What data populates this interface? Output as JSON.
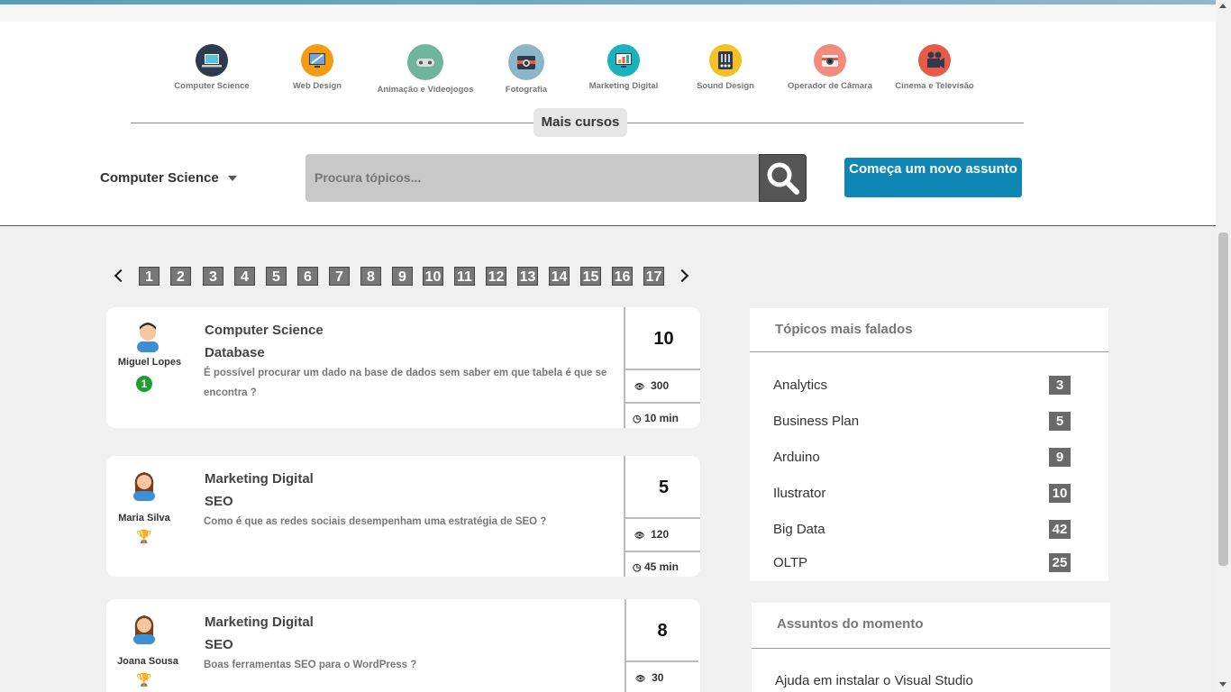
{
  "categories": [
    {
      "label": "Computer Science",
      "icon": "laptop-icon",
      "color": "#2e3b4e"
    },
    {
      "label": "Web Design",
      "icon": "web-design-icon",
      "color": "#f39c12"
    },
    {
      "label": "Animação e Videojogos",
      "icon": "gamepad-icon",
      "color": "#6fb59d"
    },
    {
      "label": "Fotografia",
      "icon": "camera-icon",
      "color": "#8bb5c9"
    },
    {
      "label": "Marketing Digital",
      "icon": "chart-screen-icon",
      "color": "#1ab2bc"
    },
    {
      "label": "Sound Design",
      "icon": "mixer-icon",
      "color": "#f4c022"
    },
    {
      "label": "Operador de Câmara",
      "icon": "camera-operator-icon",
      "color": "#f08b7e"
    },
    {
      "label": "Cinema e Televisão",
      "icon": "film-camera-icon",
      "color": "#e85a46"
    }
  ],
  "more_courses": "Mais cursos",
  "filter": {
    "selected": "Computer Science"
  },
  "search": {
    "placeholder": "Procura tópicos..."
  },
  "new_topic_button": "Começa um novo assunto",
  "pagination": {
    "pages": [
      "1",
      "2",
      "3",
      "4",
      "5",
      "6",
      "7",
      "8",
      "9",
      "10",
      "11",
      "12",
      "13",
      "14",
      "15",
      "16",
      "17"
    ]
  },
  "posts": [
    {
      "user": "Miguel Lopes",
      "badge": "1",
      "category": "Computer Science",
      "subcategory": "Database",
      "question": "É possível procurar um dado na base de dados sem saber em que tabela é que se encontra ?",
      "replies": "10",
      "views": "300",
      "time": "10 min"
    },
    {
      "user": "Maria Silva",
      "badge": "trophy",
      "category": "Marketing Digital",
      "subcategory": "SEO",
      "question": "Como é que as redes sociais desempenham uma estratégia de SEO ?",
      "replies": "5",
      "views": "120",
      "time": "45 min"
    },
    {
      "user": "Joana Sousa",
      "badge": "trophy",
      "category": "Marketing Digital",
      "subcategory": "SEO",
      "question": "Boas ferramentas SEO para o WordPress ?",
      "replies": "8",
      "views": "30",
      "time": ""
    }
  ],
  "top_topics": {
    "title": "Tópicos mais falados",
    "items": [
      {
        "name": "Analytics",
        "count": "3"
      },
      {
        "name": "Business Plan",
        "count": "5"
      },
      {
        "name": "Arduino",
        "count": "9"
      },
      {
        "name": "Ilustrator",
        "count": "10"
      },
      {
        "name": "Big Data",
        "count": "42"
      },
      {
        "name": "OLTP",
        "count": "25"
      }
    ]
  },
  "trending": {
    "title": "Assuntos do momento",
    "items": [
      "Ajuda em instalar o Visual Studio"
    ]
  },
  "colors": {
    "accent": "#1086b4",
    "pager": "#777777",
    "success": "#1e9e2e"
  }
}
